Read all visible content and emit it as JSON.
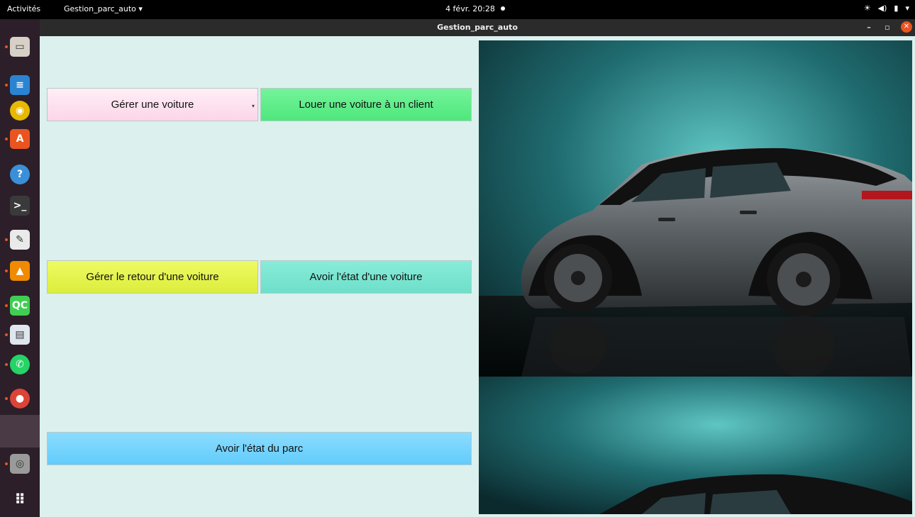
{
  "topbar": {
    "activities": "Activités",
    "app_menu": "Gestion_parc_auto ▾",
    "clock": "4 févr.  20:28"
  },
  "window": {
    "title": "Gestion_parc_auto"
  },
  "dock": {
    "items": [
      {
        "icon": "files-icon",
        "color": "#d6d0c6"
      },
      {
        "icon": "writer-icon",
        "color": "#2a84d2"
      },
      {
        "icon": "rhythmbox-icon",
        "color": "#e6b800"
      },
      {
        "icon": "software-center-icon",
        "color": "#e95420"
      },
      {
        "icon": "help-icon",
        "color": "#3a8fd8"
      },
      {
        "icon": "terminal-icon",
        "color": "#3a3a3a"
      },
      {
        "icon": "text-editor-icon",
        "color": "#eaeaea"
      },
      {
        "icon": "vlc-icon",
        "color": "#f08a00"
      },
      {
        "icon": "qt-creator-icon",
        "color": "#41cd52"
      },
      {
        "icon": "document-viewer-icon",
        "color": "#dfe6ee"
      },
      {
        "icon": "whatsapp-icon",
        "color": "#25d366"
      },
      {
        "icon": "chrome-icon",
        "color": "#db4437"
      },
      {
        "icon": "app-window-icon",
        "color": "#4a3a46"
      },
      {
        "icon": "disk-icon",
        "color": "#9a9a9a"
      },
      {
        "icon": "show-apps-icon",
        "color": "#ffffff"
      }
    ]
  },
  "app": {
    "manage_car": "Gérer une voiture",
    "rent_car": "Louer une voiture à un client",
    "return_car": "Gérer le retour d'une voiture",
    "car_state": "Avoir l'état d'une voiture",
    "park_state": "Avoir l'état du parc"
  },
  "colors": {
    "background": "#dcf0ee",
    "manage": "#fbd6e8",
    "rent": "#4ee77c",
    "return": "#dced3d",
    "state": "#6edfca",
    "park": "#62ccfb"
  }
}
